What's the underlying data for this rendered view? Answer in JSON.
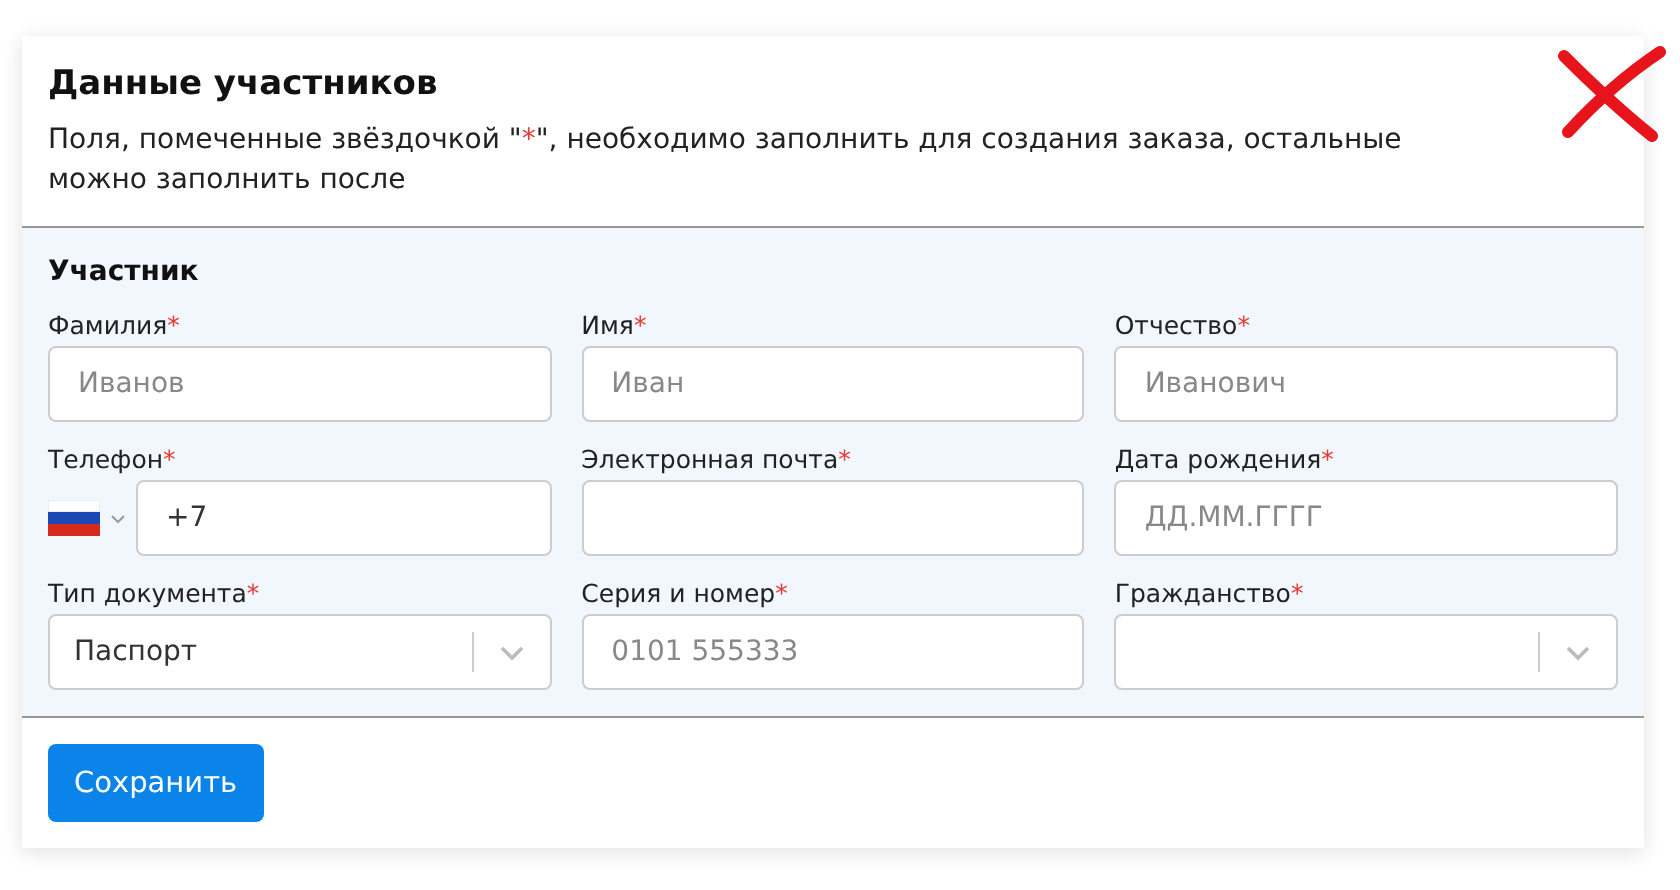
{
  "dialog": {
    "title": "Данные участников",
    "note": {
      "before": "Поля, помеченные звёздочкой \"",
      "mark": "*",
      "after": "\", необходимо заполнить для создания заказа, остальные можно заполнить после"
    }
  },
  "section": {
    "title": "Участник",
    "fields": [
      {
        "label": "Фамилия",
        "mark": "*",
        "kind": "text",
        "placeholder": "Иванов"
      },
      {
        "label": "Имя",
        "mark": "*",
        "kind": "text",
        "placeholder": "Иван"
      },
      {
        "label": "Отчество",
        "mark": "*",
        "kind": "text",
        "placeholder": "Иванович"
      },
      {
        "label": "Телефон",
        "mark": "*",
        "kind": "phone",
        "value": "+7"
      },
      {
        "label": "Электронная почта",
        "mark": "*",
        "kind": "text"
      },
      {
        "label": "Дата рождения",
        "mark": "*",
        "kind": "text",
        "placeholder": "ДД.ММ.ГГГГ"
      },
      {
        "label": "Тип документа",
        "mark": "*",
        "kind": "select",
        "value": "Паспорт"
      },
      {
        "label": "Серия и номер",
        "mark": "*",
        "kind": "text",
        "placeholder": "0101 555333"
      },
      {
        "label": "Гражданство",
        "mark": "*",
        "kind": "select"
      }
    ]
  },
  "buttons": [
    "Сохранить"
  ]
}
